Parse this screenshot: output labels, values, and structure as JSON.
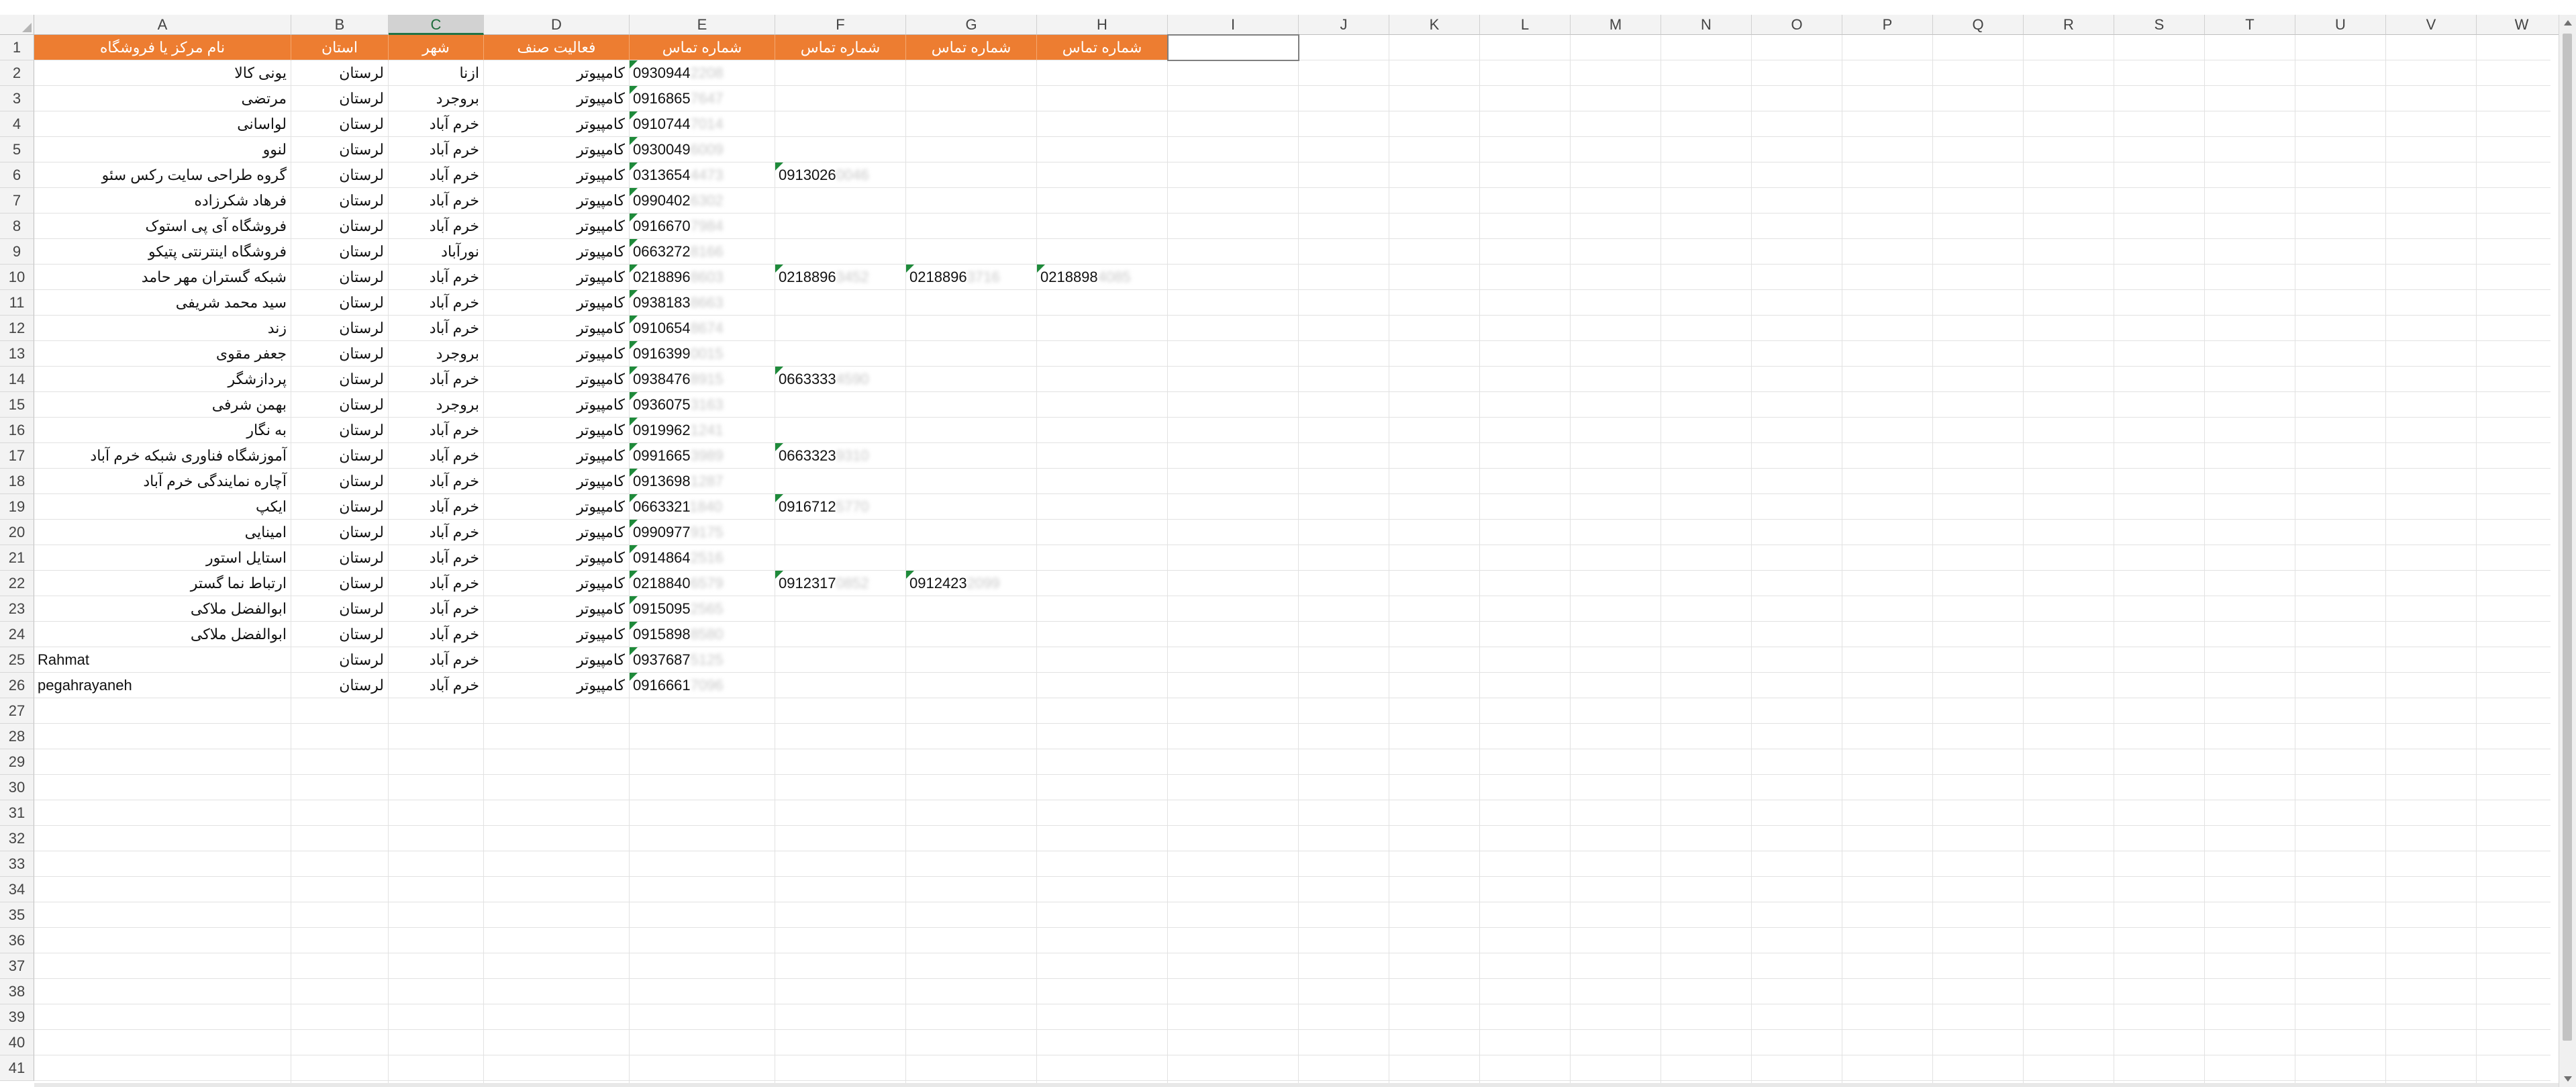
{
  "sheet": {
    "column_letters": [
      "A",
      "B",
      "C",
      "D",
      "E",
      "F",
      "G",
      "H",
      "I",
      "J",
      "K",
      "L",
      "M",
      "N",
      "O",
      "P",
      "Q",
      "R",
      "S",
      "T",
      "U",
      "V",
      "W"
    ],
    "selected_column": "C",
    "row_count": 41,
    "header_row": [
      "نام مرکز یا فروشگاه",
      "استان",
      "شهر",
      "فعالیت صنف",
      "شماره تماس",
      "شماره تماس",
      "شماره تماس",
      "شماره تماس"
    ],
    "rows": [
      {
        "name": "یونی کالا",
        "province": "لرستان",
        "city": "ازنا",
        "activity": "کامپیوتر",
        "phones": [
          {
            "v": "0930944",
            "m": "2208"
          }
        ]
      },
      {
        "name": "مرتضی",
        "province": "لرستان",
        "city": "بروجرد",
        "activity": "کامپیوتر",
        "phones": [
          {
            "v": "0916865",
            "m": "7647"
          }
        ]
      },
      {
        "name": "لواسانی",
        "province": "لرستان",
        "city": "خرم آباد",
        "activity": "کامپیوتر",
        "phones": [
          {
            "v": "0910744",
            "m": "7014"
          }
        ]
      },
      {
        "name": "لنوو",
        "province": "لرستان",
        "city": "خرم آباد",
        "activity": "کامپیوتر",
        "phones": [
          {
            "v": "0930049",
            "m": "6009"
          }
        ]
      },
      {
        "name": "گروه طراحی سایت رکس سئو",
        "province": "لرستان",
        "city": "خرم آباد",
        "activity": "کامپیوتر",
        "phones": [
          {
            "v": "0313654",
            "m": "4473"
          },
          {
            "v": "0913026",
            "m": "0046"
          }
        ]
      },
      {
        "name": "فرهاد شکرزاده",
        "province": "لرستان",
        "city": "خرم آباد",
        "activity": "کامپیوتر",
        "phones": [
          {
            "v": "0990402",
            "m": "6302"
          }
        ]
      },
      {
        "name": "فروشگاه آی پی استوک",
        "province": "لرستان",
        "city": "خرم آباد",
        "activity": "کامپیوتر",
        "phones": [
          {
            "v": "0916670",
            "m": "7984"
          }
        ]
      },
      {
        "name": "فروشگاه اینترنتی پتیکو",
        "province": "لرستان",
        "city": "نورآباد",
        "activity": "کامپیوتر",
        "phones": [
          {
            "v": "0663272",
            "m": "8166"
          }
        ]
      },
      {
        "name": "شبکه گستران مهر حامد",
        "province": "لرستان",
        "city": "خرم آباد",
        "activity": "کامپیوتر",
        "phones": [
          {
            "v": "0218896",
            "m": "8603"
          },
          {
            "v": "0218896",
            "m": "3452"
          },
          {
            "v": "0218896",
            "m": "3716"
          },
          {
            "v": "0218898",
            "m": "4085"
          }
        ]
      },
      {
        "name": "سید محمد شریفی",
        "province": "لرستان",
        "city": "خرم آباد",
        "activity": "کامپیوتر",
        "phones": [
          {
            "v": "0938183",
            "m": "8663"
          }
        ]
      },
      {
        "name": "زند",
        "province": "لرستان",
        "city": "خرم آباد",
        "activity": "کامپیوتر",
        "phones": [
          {
            "v": "0910654",
            "m": "8674"
          }
        ]
      },
      {
        "name": "جعفر مقوی",
        "province": "لرستان",
        "city": "بروجرد",
        "activity": "کامپیوتر",
        "phones": [
          {
            "v": "0916399",
            "m": "0015"
          }
        ]
      },
      {
        "name": "پردازشگر",
        "province": "لرستان",
        "city": "خرم آباد",
        "activity": "کامپیوتر",
        "phones": [
          {
            "v": "0938476",
            "m": "8915"
          },
          {
            "v": "0663333",
            "m": "4590"
          }
        ]
      },
      {
        "name": "بهمن شرفی",
        "province": "لرستان",
        "city": "بروجرد",
        "activity": "کامپیوتر",
        "phones": [
          {
            "v": "0936075",
            "m": "3163"
          }
        ]
      },
      {
        "name": "به نگار",
        "province": "لرستان",
        "city": "خرم آباد",
        "activity": "کامپیوتر",
        "phones": [
          {
            "v": "0919962",
            "m": "1241"
          }
        ]
      },
      {
        "name": "آموزشگاه فناوری شبکه خرم آباد",
        "province": "لرستان",
        "city": "خرم آباد",
        "activity": "کامپیوتر",
        "phones": [
          {
            "v": "0991665",
            "m": "3989"
          },
          {
            "v": "0663323",
            "m": "9310"
          }
        ]
      },
      {
        "name": "آچاره نمایندگی خرم آباد",
        "province": "لرستان",
        "city": "خرم آباد",
        "activity": "کامپیوتر",
        "phones": [
          {
            "v": "0913698",
            "m": "1287"
          }
        ]
      },
      {
        "name": "ایکپ",
        "province": "لرستان",
        "city": "خرم آباد",
        "activity": "کامپیوتر",
        "phones": [
          {
            "v": "0663321",
            "m": "1840"
          },
          {
            "v": "0916712",
            "m": "5770"
          }
        ]
      },
      {
        "name": "امینایی",
        "province": "لرستان",
        "city": "خرم آباد",
        "activity": "کامپیوتر",
        "phones": [
          {
            "v": "0990977",
            "m": "9175"
          }
        ]
      },
      {
        "name": "استایل استور",
        "province": "لرستان",
        "city": "خرم آباد",
        "activity": "کامپیوتر",
        "phones": [
          {
            "v": "0914864",
            "m": "2516"
          }
        ]
      },
      {
        "name": "ارتباط نما گستر",
        "province": "لرستان",
        "city": "خرم آباد",
        "activity": "کامپیوتر",
        "phones": [
          {
            "v": "0218840",
            "m": "6579"
          },
          {
            "v": "0912317",
            "m": "0852"
          },
          {
            "v": "0912423",
            "m": "2099"
          }
        ]
      },
      {
        "name": "ابوالفضل ملاکی",
        "province": "لرستان",
        "city": "خرم آباد",
        "activity": "کامپیوتر",
        "phones": [
          {
            "v": "0915095",
            "m": "2565"
          }
        ]
      },
      {
        "name": "ابوالفضل ملاکی",
        "province": "لرستان",
        "city": "خرم آباد",
        "activity": "کامپیوتر",
        "phones": [
          {
            "v": "0915898",
            "m": "8580"
          }
        ]
      },
      {
        "name": "Rahmat",
        "province": "لرستان",
        "city": "خرم آباد",
        "activity": "کامپیوتر",
        "phones": [
          {
            "v": "0937687",
            "m": "5125"
          }
        ]
      },
      {
        "name": "pegahrayaneh",
        "province": "لرستان",
        "city": "خرم آباد",
        "activity": "کامپیوتر",
        "phones": [
          {
            "v": "0916661",
            "m": "7096"
          }
        ]
      }
    ]
  },
  "colors": {
    "header_fill": "#ed7d31",
    "header_text": "#ffffff",
    "comment_flag": "#1e8a3a",
    "selected_col_accent": "#217346"
  }
}
